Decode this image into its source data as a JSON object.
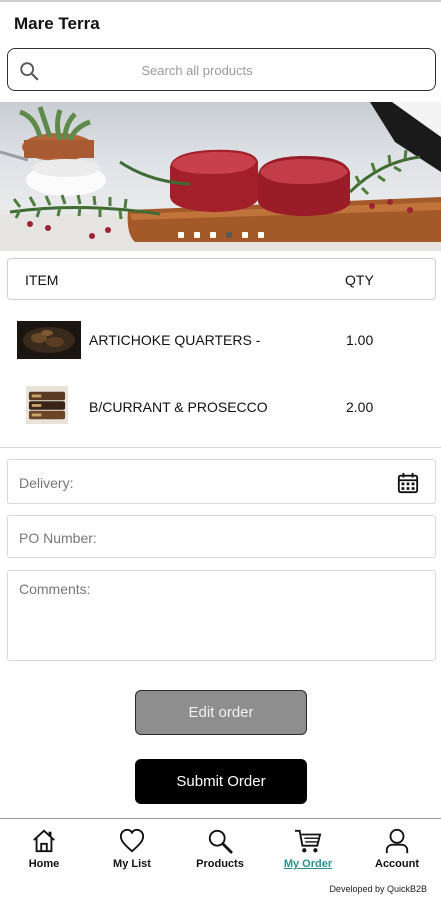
{
  "app": {
    "title": "Mare Terra"
  },
  "search": {
    "placeholder": "Search all products",
    "value": ""
  },
  "banner": {
    "slides": 6,
    "active_slide": 3
  },
  "order_table": {
    "headers": {
      "item": "ITEM",
      "qty": "QTY"
    },
    "rows": [
      {
        "name": "ARTICHOKE QUARTERS -",
        "qty": "1.00"
      },
      {
        "name": "B/CURRANT & PROSECCO",
        "qty": "2.00"
      }
    ]
  },
  "form": {
    "delivery_label": "Delivery:",
    "po_label": "PO Number:",
    "comments_label": "Comments:"
  },
  "actions": {
    "edit_label": "Edit order",
    "submit_label": "Submit Order"
  },
  "nav": {
    "items": [
      {
        "label": "Home",
        "icon": "home-icon"
      },
      {
        "label": "My List",
        "icon": "heart-icon"
      },
      {
        "label": "Products",
        "icon": "search-icon"
      },
      {
        "label": "My Order",
        "icon": "cart-icon",
        "active": true
      },
      {
        "label": "Account",
        "icon": "user-icon"
      }
    ],
    "active_color": "#2a8f8f"
  },
  "footer": {
    "credit": "Developed by QuickB2B"
  }
}
